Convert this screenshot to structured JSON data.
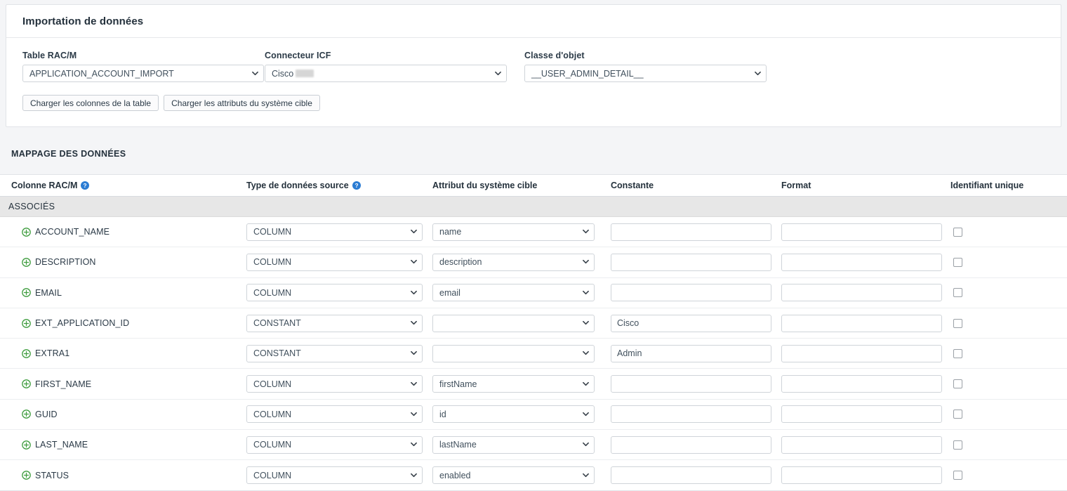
{
  "card": {
    "title": "Importation de données",
    "fields": [
      {
        "label": "Table RAC/M",
        "value": "APPLICATION_ACCOUNT_IMPORT",
        "redacted": false
      },
      {
        "label": "Connecteur ICF",
        "value": "Cisco",
        "redacted": true
      },
      {
        "label": "Classe d'objet",
        "value": "__USER_ADMIN_DETAIL__",
        "redacted": false
      }
    ],
    "buttons": [
      {
        "label": "Charger les colonnes de la table"
      },
      {
        "label": "Charger les attributs du système cible"
      }
    ]
  },
  "mapping": {
    "section_title": "MAPPAGE DES DONNÉES",
    "columns": [
      {
        "label": "Colonne RAC/M",
        "help": true,
        "help_icon": "help-circle-icon"
      },
      {
        "label": "Type de données source",
        "help": true,
        "help_icon": "help-circle-icon"
      },
      {
        "label": "Attribut du système cible",
        "help": false
      },
      {
        "label": "Constante",
        "help": false
      },
      {
        "label": "Format",
        "help": false
      },
      {
        "label": "Identifiant unique",
        "help": false
      }
    ],
    "group_label": "ASSOCIÉS",
    "expand_icon": "plus-circle-icon",
    "rows": [
      {
        "name": "ACCOUNT_NAME",
        "source_type": "COLUMN",
        "target_attribute": "name",
        "constant": "",
        "format": "",
        "unique_id": false
      },
      {
        "name": "DESCRIPTION",
        "source_type": "COLUMN",
        "target_attribute": "description",
        "constant": "",
        "format": "",
        "unique_id": false
      },
      {
        "name": "EMAIL",
        "source_type": "COLUMN",
        "target_attribute": "email",
        "constant": "",
        "format": "",
        "unique_id": false
      },
      {
        "name": "EXT_APPLICATION_ID",
        "source_type": "CONSTANT",
        "target_attribute": "",
        "constant": "Cisco",
        "format": "",
        "unique_id": false
      },
      {
        "name": "EXTRA1",
        "source_type": "CONSTANT",
        "target_attribute": "",
        "constant": "Admin",
        "format": "",
        "unique_id": false
      },
      {
        "name": "FIRST_NAME",
        "source_type": "COLUMN",
        "target_attribute": "firstName",
        "constant": "",
        "format": "",
        "unique_id": false
      },
      {
        "name": "GUID",
        "source_type": "COLUMN",
        "target_attribute": "id",
        "constant": "",
        "format": "",
        "unique_id": false
      },
      {
        "name": "LAST_NAME",
        "source_type": "COLUMN",
        "target_attribute": "lastName",
        "constant": "",
        "format": "",
        "unique_id": false
      },
      {
        "name": "STATUS",
        "source_type": "COLUMN",
        "target_attribute": "enabled",
        "constant": "",
        "format": "",
        "unique_id": false
      }
    ]
  },
  "colors": {
    "page_bg": "#f4f5f7",
    "card_bg": "#ffffff",
    "border": "#e1e4e8",
    "text": "#2b3a47",
    "help_icon": "#2b7cd3",
    "plus_icon": "#3f9d3f",
    "group_header_bg": "#e7e7e7"
  }
}
